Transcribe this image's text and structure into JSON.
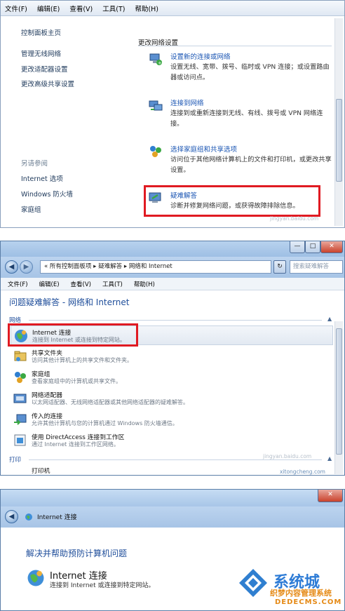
{
  "panel1": {
    "menu": [
      "文件(F)",
      "编辑(E)",
      "查看(V)",
      "工具(T)",
      "帮助(H)"
    ],
    "sidebar": {
      "home": "控制面板主页",
      "links": [
        "管理无线网络",
        "更改适配器设置",
        "更改高级共享设置"
      ],
      "see_also_heading": "另请参阅",
      "see_also": [
        "Internet 选项",
        "Windows 防火墙",
        "家庭组"
      ]
    },
    "section_heading": "更改网络设置",
    "tasks": [
      {
        "icon": "network-setup-icon",
        "title": "设置新的连接或网络",
        "desc": "设置无线、宽带、拨号、临时或 VPN 连接；或设置路由器或访问点。"
      },
      {
        "icon": "connect-network-icon",
        "title": "连接到网络",
        "desc": "连接到或重新连接到无线、有线、拨号或 VPN 网络连接。"
      },
      {
        "icon": "homegroup-icon",
        "title": "选择家庭组和共享选项",
        "desc": "访问位于其他网络计算机上的文件和打印机，或更改共享设置。"
      },
      {
        "icon": "troubleshoot-icon",
        "title": "疑难解答",
        "desc": "诊断并修复网络问题，或获得故障排除信息。"
      }
    ],
    "watermark": "jingyan.baidu.com"
  },
  "panel2": {
    "window_buttons": [
      "—",
      "□",
      "✕"
    ],
    "breadcrumb": [
      "«",
      "所有控制面板项",
      "▸",
      "疑难解答",
      "▸",
      "网络和 Internet"
    ],
    "search_placeholder": "搜索疑难解答",
    "menu": [
      "文件(F)",
      "编辑(E)",
      "查看(V)",
      "工具(T)",
      "帮助(H)"
    ],
    "title": "问题疑难解答 - 网络和 Internet",
    "group_network": "网络",
    "group_print": "打印",
    "items": [
      {
        "icon": "internet-connection-icon",
        "title": "Internet 连接",
        "desc": "连接到 Internet 或连接到特定网站。"
      },
      {
        "icon": "shared-folder-icon",
        "title": "共享文件夹",
        "desc": "访问其他计算机上的共享文件和文件夹。"
      },
      {
        "icon": "homegroup-icon",
        "title": "家庭组",
        "desc": "查看家庭组中的计算机或共享文件。"
      },
      {
        "icon": "network-adapter-icon",
        "title": "网络适配器",
        "desc": "以太网适配器、无线网络适配器或其他网络适配器的疑难解答。"
      },
      {
        "icon": "incoming-connection-icon",
        "title": "传入的连接",
        "desc": "允许其他计算机与您的计算机通过 Windows 防火墙通信。"
      },
      {
        "icon": "directaccess-icon",
        "title": "使用 DirectAccess 连接到工作区",
        "desc": "通过 Internet 连接到工作区网络。"
      }
    ],
    "print_item": "打印机",
    "watermark": "jingyan.baidu.com",
    "watermark2": "xitongcheng.com"
  },
  "panel3": {
    "window_buttons": [
      "✕"
    ],
    "breadcrumb": "Internet 连接",
    "title": "解决并帮助预防计算机问题",
    "item_title": "Internet 连接",
    "item_desc": "连接到 Internet 或连接到特定网站。",
    "watermark_brand": "系统城",
    "watermark_cn": "织梦内容管理系统",
    "watermark_url": "DEDECMS.COM"
  }
}
